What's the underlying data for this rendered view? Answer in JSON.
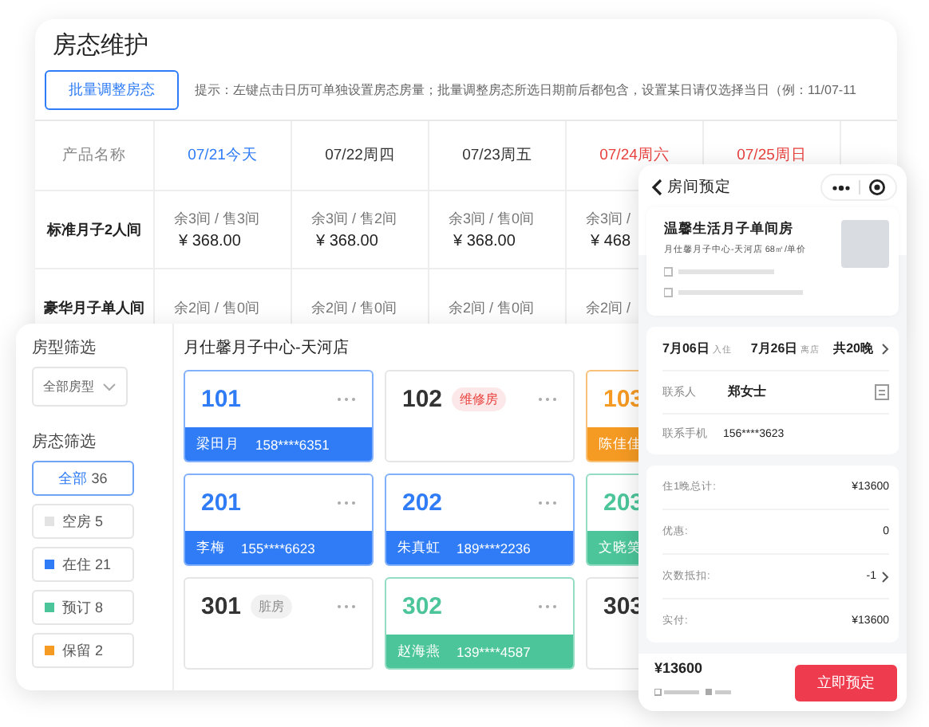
{
  "back_panel": {
    "title": "房态维护",
    "batch_button": "批量调整房态",
    "hint": "提示：左键点击日历可单独设置房态房量；批量调整房态所选日期前后都包含，设置某日请仅选择当日（例：11/07-11",
    "columns": [
      {
        "label": "产品名称",
        "kind": "plain"
      },
      {
        "label": "07/21今天",
        "kind": "today"
      },
      {
        "label": "07/22周四",
        "kind": "weekday"
      },
      {
        "label": "07/23周五",
        "kind": "weekday"
      },
      {
        "label": "07/24周六",
        "kind": "weekend"
      },
      {
        "label": "07/25周日",
        "kind": "weekend"
      }
    ],
    "rows": [
      {
        "cells": [
          {
            "name": "标准月子2人间"
          },
          {
            "stock": "余3间 / 售3间",
            "price": "¥ 368.00"
          },
          {
            "stock": "余3间 / 售2间",
            "price": "¥ 368.00"
          },
          {
            "stock": "余3间 / 售0间",
            "price": "¥ 368.00"
          },
          {
            "stock": "余3间 /",
            "price": "¥ 468"
          }
        ]
      },
      {
        "cells": [
          {
            "name": "豪华月子单人间"
          },
          {
            "stock": "余2间 / 售0间"
          },
          {
            "stock": "余2间 / 售0间"
          },
          {
            "stock": "余2间 / 售0间"
          },
          {
            "stock": "余2间 /"
          }
        ]
      }
    ]
  },
  "front_panel": {
    "type_filter_label": "房型筛选",
    "type_dropdown": "全部房型",
    "status_filter_label": "房态筛选",
    "filters": [
      {
        "label": "全部",
        "count": "36",
        "selected": true
      },
      {
        "label": "空房",
        "count": "5",
        "selected": false,
        "color": "#e3e3e3"
      },
      {
        "label": "在住",
        "count": "21",
        "selected": false,
        "color": "#2f7cf6"
      },
      {
        "label": "预订",
        "count": "8",
        "selected": false,
        "color": "#4cc59a"
      },
      {
        "label": "保留",
        "count": "2",
        "selected": false,
        "color": "#f59a23"
      }
    ],
    "store": "月仕馨月子中心-天河店",
    "rooms": [
      {
        "number": "101",
        "color": "#2f7cf6",
        "guest": "梁田月",
        "phone": "158****6351"
      },
      {
        "number": "102",
        "tag": {
          "text": "维修房",
          "color": "#e8423f"
        }
      },
      {
        "number": "103",
        "color": "#f59a23",
        "guest": "陈佳佳"
      },
      {
        "number": "201",
        "color": "#2f7cf6",
        "guest": "李梅",
        "phone": "155****6623"
      },
      {
        "number": "202",
        "color": "#2f7cf6",
        "guest": "朱真虹",
        "phone": "189****2236"
      },
      {
        "number": "203",
        "color": "#4cc59a",
        "guest": "文晓笑"
      },
      {
        "number": "301",
        "tag": {
          "text": "脏房",
          "color": "#8c8c8c"
        }
      },
      {
        "number": "302",
        "color": "#4cc59a",
        "guest": "赵海燕",
        "phone": "139****4587"
      },
      {
        "number": "303"
      }
    ]
  },
  "phone": {
    "title": "房间预定",
    "room_name": "温馨生活月子单间房",
    "room_sub": "月仕馨月子中心-天河店 68㎡/单价",
    "checkin": "7月06日",
    "checkin_label": "入住",
    "checkout": "7月26日",
    "checkout_label": "离店",
    "nights": "共20晚",
    "contact_label": "联系人",
    "contact": "郑女士",
    "mobile_label": "联系手机",
    "mobile": "156****3623",
    "price_rows": [
      {
        "label": "住1晚总计:",
        "value": "¥13600",
        "kind": "plain"
      },
      {
        "label": "优惠:",
        "value": "0",
        "kind": "plain"
      },
      {
        "label": "次数抵扣:",
        "value": "-1",
        "kind": "link"
      },
      {
        "label": "实付:",
        "value": "¥13600",
        "kind": "plain"
      }
    ],
    "total": "¥13600",
    "book_button": "立即预定"
  }
}
